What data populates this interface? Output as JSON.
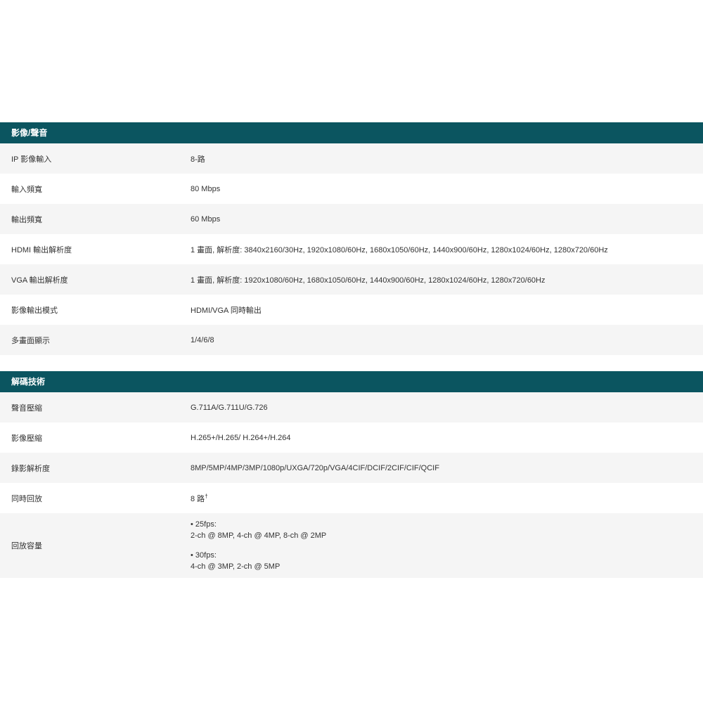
{
  "sections": [
    {
      "title": "影像/聲音",
      "rows": [
        {
          "label": "IP 影像輸入",
          "value": "8-路"
        },
        {
          "label": "輸入頻寬",
          "value": "80 Mbps"
        },
        {
          "label": "輸出頻寬",
          "value": "60 Mbps"
        },
        {
          "label": "HDMI 輸出解析度",
          "value": "1 畫面, 解析度: 3840x2160/30Hz, 1920x1080/60Hz, 1680x1050/60Hz, 1440x900/60Hz, 1280x1024/60Hz, 1280x720/60Hz"
        },
        {
          "label": "VGA 輸出解析度",
          "value": "1 畫面, 解析度: 1920x1080/60Hz, 1680x1050/60Hz, 1440x900/60Hz, 1280x1024/60Hz, 1280x720/60Hz"
        },
        {
          "label": "影像輸出模式",
          "value": "HDMI/VGA 同時輸出"
        },
        {
          "label": "多畫面顯示",
          "value": "1/4/6/8"
        }
      ]
    },
    {
      "title": "解碼技術",
      "rows": [
        {
          "label": "聲音壓縮",
          "value": "G.711A/G.711U/G.726"
        },
        {
          "label": "影像壓縮",
          "value": "H.265+/H.265/ H.264+/H.264"
        },
        {
          "label": "錄影解析度",
          "value": "8MP/5MP/4MP/3MP/1080p/UXGA/720p/VGA/4CIF/DCIF/2CIF/CIF/QCIF"
        },
        {
          "label": "同時回放",
          "value": "8 路",
          "superscript": "†"
        },
        {
          "label": "回放容量",
          "bullets": [
            {
              "head": "• 25fps:",
              "detail": "2-ch @ 8MP, 4-ch @ 4MP, 8-ch @ 2MP"
            },
            {
              "head": "• 30fps:",
              "detail": "4-ch @ 3MP, 2-ch @ 5MP"
            }
          ]
        }
      ]
    }
  ]
}
